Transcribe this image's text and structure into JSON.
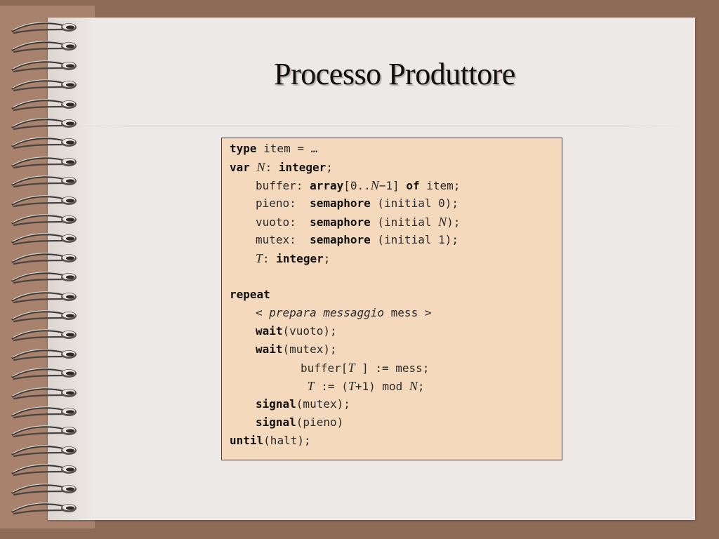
{
  "slide": {
    "title": "Processo Produttore"
  },
  "code": {
    "l1_kw": "type",
    "l1_rest": " item = …",
    "l2_kw": "var",
    "l2_var": "N",
    "l2_colon": ": ",
    "l2_type": "integer",
    "l2_semi": ";",
    "l3_name": "buffer: ",
    "l3_kw": "array",
    "l3_range_a": "[0..",
    "l3_var": "N",
    "l3_range_b": "−1] ",
    "l3_of": "of",
    "l3_rest": " item;",
    "l4_name": "pieno:  ",
    "l4_kw": "semaphore",
    "l4_rest": " (initial 0);",
    "l5_name": "vuoto:  ",
    "l5_kw": "semaphore",
    "l5_rest_a": " (initial ",
    "l5_var": "N",
    "l5_rest_b": ");",
    "l6_name": "mutex:  ",
    "l6_kw": "semaphore",
    "l6_rest": " (initial 1);",
    "l7_var": "T",
    "l7_colon": ": ",
    "l7_type": "integer",
    "l7_semi": ";",
    "l8_kw": "repeat",
    "l9_a": "< ",
    "l9_it": "prepara messaggio",
    "l9_b": " mess >",
    "l10_kw": "wait",
    "l10_rest": "(vuoto);",
    "l11_kw": "wait",
    "l11_rest": "(mutex);",
    "l12_a": "buffer[",
    "l12_var": "T",
    "l12_b": " ] := mess;",
    "l13_var": "T",
    "l13_a": " := (",
    "l13_var2": "T",
    "l13_b": "+1) mod ",
    "l13_var3": "N",
    "l13_c": ";",
    "l14_kw": "signal",
    "l14_rest": "(mutex);",
    "l15_kw": "signal",
    "l15_rest": "(pieno)",
    "l16_kw": "until",
    "l16_rest": "(halt);"
  }
}
